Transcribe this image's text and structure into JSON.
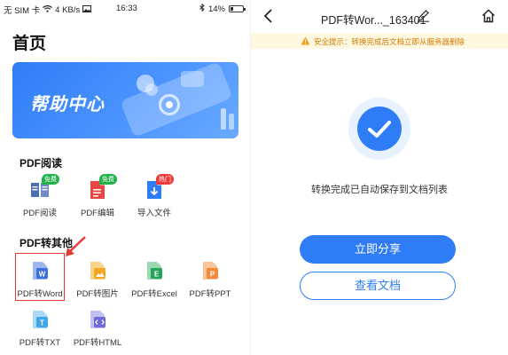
{
  "left": {
    "status_bar": {
      "carrier": "无 SIM 卡",
      "speed": "4 KB/s",
      "time": "16:33",
      "battery": "14%"
    },
    "page_title": "首页",
    "banner": {
      "text": "帮助中心"
    },
    "sections": [
      {
        "title": "PDF阅读",
        "tools": [
          {
            "label": "PDF阅读",
            "badge": "免费",
            "icon": "book-icon",
            "color": "#4a6fb5"
          },
          {
            "label": "PDF编辑",
            "badge": "免费",
            "icon": "pdf-edit-icon",
            "color": "#e84545"
          },
          {
            "label": "导入文件",
            "badge": "热门",
            "icon": "import-icon",
            "color": "#2f7df6"
          }
        ]
      },
      {
        "title": "PDF转其他",
        "tools": [
          {
            "label": "PDF转Word",
            "icon": "word-icon",
            "color": "#3b6fd9"
          },
          {
            "label": "PDF转图片",
            "icon": "image-icon",
            "color": "#f2a623"
          },
          {
            "label": "PDF转Excel",
            "icon": "excel-icon",
            "color": "#27a35a"
          },
          {
            "label": "PDF转PPT",
            "icon": "ppt-icon",
            "color": "#f28a3a"
          },
          {
            "label": "PDF转TXT",
            "icon": "txt-icon",
            "color": "#3fa7e8"
          },
          {
            "label": "PDF转HTML",
            "icon": "html-icon",
            "color": "#6f6ad8"
          }
        ]
      }
    ]
  },
  "right": {
    "title": "PDF转Wor..._163401",
    "warning": "安全提示：转换完成后文档立即从服务器删除",
    "message": "转换完成已自动保存到文档列表",
    "share_button": "立即分享",
    "view_button": "查看文档"
  },
  "colors": {
    "accent": "#2f7df6",
    "warning_bg": "#fff8e1",
    "warning_text": "#d17a00",
    "highlight": "#e53935"
  }
}
